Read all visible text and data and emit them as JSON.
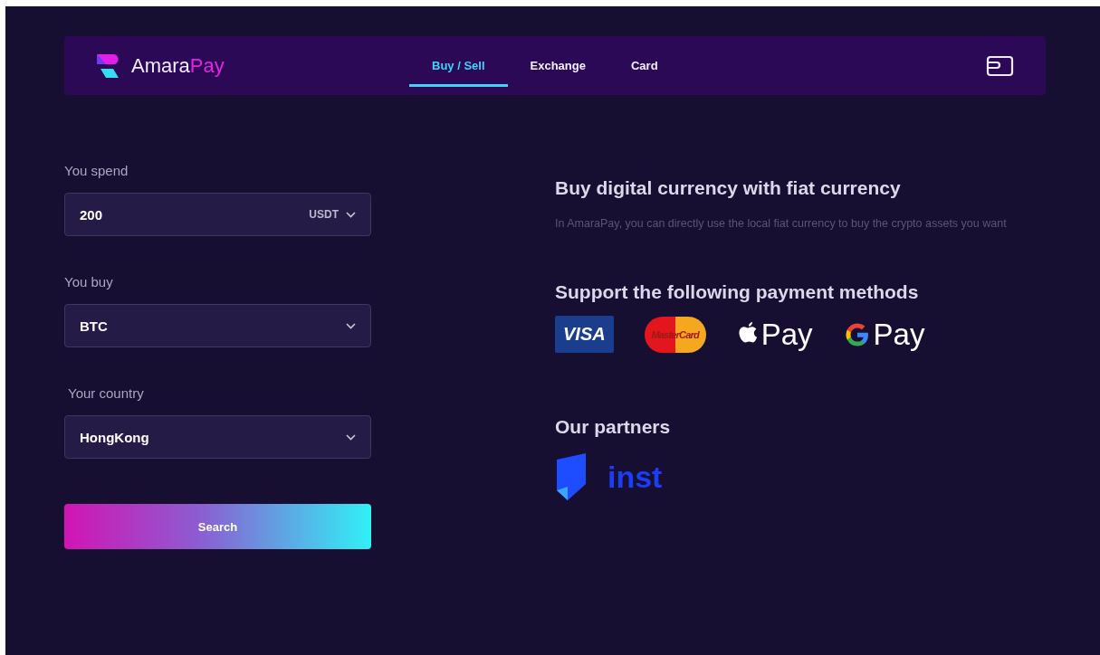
{
  "brand": {
    "name": "Amara",
    "accent": "Pay"
  },
  "nav": {
    "tabs": [
      {
        "label": "Buy / Sell",
        "selected": true
      },
      {
        "label": "Exchange",
        "selected": false
      },
      {
        "label": "Card",
        "selected": false
      }
    ]
  },
  "form": {
    "fields": [
      {
        "kind": "input",
        "label": "You spend",
        "value": "200",
        "unit": "USDT"
      },
      {
        "kind": "select",
        "label": "You buy",
        "value": "BTC"
      },
      {
        "kind": "select",
        "label": "Your country",
        "value": "HongKong"
      }
    ],
    "button": "Search"
  },
  "info": {
    "title": "Buy digital currency with fiat currency",
    "description": "In AmaraPay, you can directly use the local fiat currency to buy the crypto assets you want",
    "payments_title": "Support the following payment methods",
    "payments": [
      {
        "kind": "visa",
        "text": "VISA"
      },
      {
        "kind": "mastercard",
        "text": "MasterCard"
      },
      {
        "kind": "apple",
        "text": "Pay"
      },
      {
        "kind": "google",
        "text": "Pay"
      }
    ],
    "partners_title": "Our partners",
    "partners": [
      {
        "kind": "inst",
        "text": "inst"
      }
    ]
  }
}
